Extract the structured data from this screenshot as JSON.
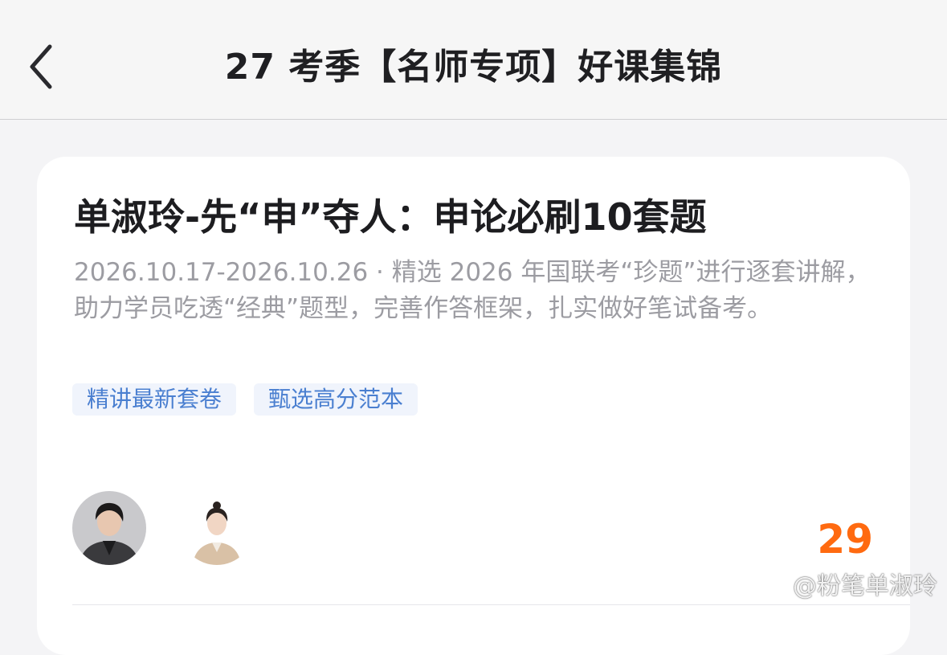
{
  "header": {
    "title": "27 考季【名师专项】好课集锦",
    "back_icon": "chevron-left-icon"
  },
  "course": {
    "title": "单淑玲-先“申”夺人：申论必刷10套题",
    "date_range": "2026.10.17-2026.10.26",
    "separator": " · ",
    "description": "精选 2026 年国联考“珍题”进行逐套讲解，助力学员吃透“经典”题型，完善作答框架，扎实做好笔试备考。",
    "tags": [
      "精讲最新套卷",
      "甄选高分范本"
    ],
    "count": "29"
  },
  "watermark": {
    "text": "@粉笔单淑玲",
    "icon": "weibo-icon"
  },
  "colors": {
    "accent_orange": "#ff6a10",
    "tag_blue": "#4a7fd0",
    "tag_bg": "#f0f4fc"
  }
}
